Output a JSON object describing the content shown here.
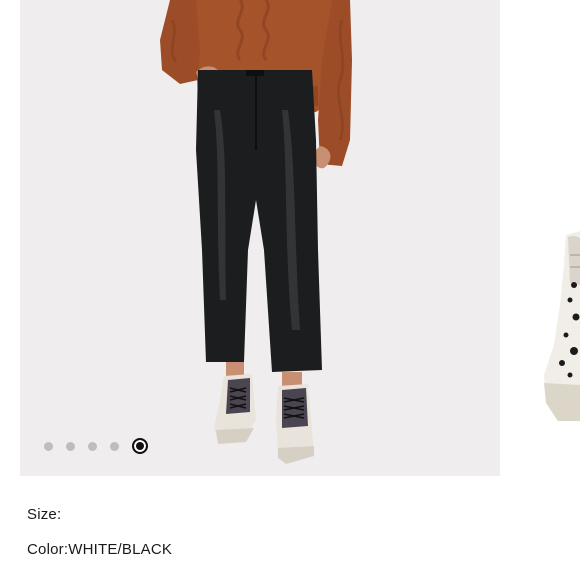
{
  "product": {
    "size_label": "Size:",
    "size_value": "",
    "color_label": "Color:",
    "color_value": "WHITE/BLACK"
  },
  "carousel": {
    "slide_count": 5,
    "active_index": 4,
    "slide_bg": "#efedee",
    "active_dot_color": "#111111",
    "inactive_dot_color": "#bdbdbd"
  },
  "colors": {
    "sweater": "#a5532b",
    "pants": "#1c1d1f",
    "skin": "#c98f72",
    "sneaker_white": "#e8e4dc"
  }
}
